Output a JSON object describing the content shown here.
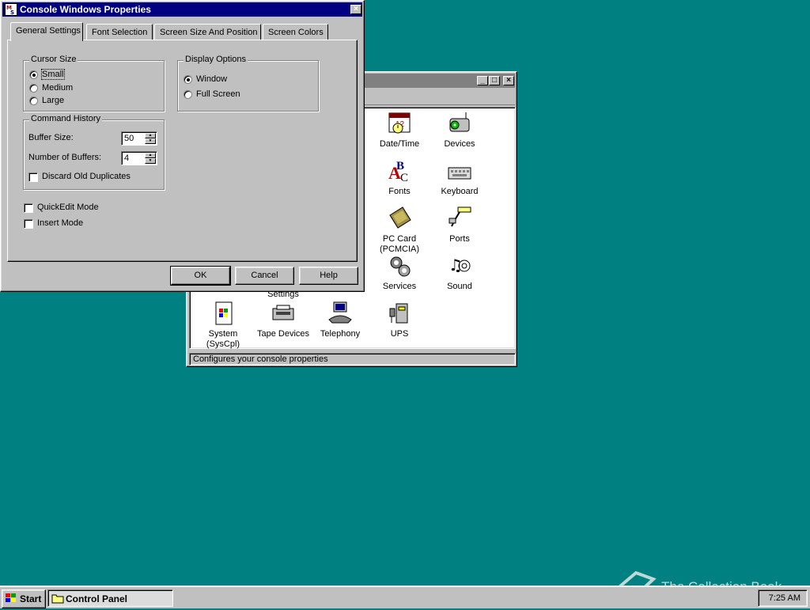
{
  "control_panel": {
    "status_text": "Configures your console properties",
    "icons": [
      {
        "name": "date-time-icon",
        "label": "Date/Time"
      },
      {
        "name": "devices-icon",
        "label": "Devices"
      },
      {
        "name": "fonts-icon",
        "label": "Fonts"
      },
      {
        "name": "keyboard-icon",
        "label": "Keyboard"
      },
      {
        "name": "pc-card-icon",
        "label": "PC Card\n(PCMCIA)"
      },
      {
        "name": "ports-icon",
        "label": "Ports"
      },
      {
        "name": "services-icon",
        "label": "Services"
      },
      {
        "name": "sound-icon",
        "label": "Sound"
      },
      {
        "name": "settings-icon",
        "label": "Settings"
      },
      {
        "name": "system-icon",
        "label": "System\n(SysCpl)"
      },
      {
        "name": "tape-devices-icon",
        "label": "Tape Devices"
      },
      {
        "name": "telephony-icon",
        "label": "Telephony"
      },
      {
        "name": "ups-icon",
        "label": "UPS"
      }
    ]
  },
  "dialog": {
    "title": "Console Windows Properties",
    "tabs": [
      "General Settings",
      "Font Selection",
      "Screen Size And Position",
      "Screen Colors"
    ],
    "cursor_size": {
      "title": "Cursor Size",
      "options": [
        "Small",
        "Medium",
        "Large"
      ],
      "selected": "Small"
    },
    "display_options": {
      "title": "Display Options",
      "options": [
        "Window",
        "Full Screen"
      ],
      "selected": "Window"
    },
    "command_history": {
      "title": "Command History",
      "buffer_size_label": "Buffer Size:",
      "buffer_size_value": "50",
      "num_buffers_label": "Number of Buffers:",
      "num_buffers_value": "4",
      "discard_label": "Discard Old Duplicates",
      "discard_checked": false
    },
    "quickedit_label": "QuickEdit Mode",
    "quickedit_checked": false,
    "insert_label": "Insert Mode",
    "insert_checked": false,
    "buttons": {
      "ok": "OK",
      "cancel": "Cancel",
      "help": "Help"
    }
  },
  "taskbar": {
    "start_label": "Start",
    "task_label": "Control Panel",
    "clock": "7:25 AM"
  },
  "watermark": "The Collection Book",
  "colors": {
    "desktop": "#008080",
    "titlebar_active": "#000080",
    "titlebar_inactive": "#808080",
    "face": "#c0c0c0"
  }
}
